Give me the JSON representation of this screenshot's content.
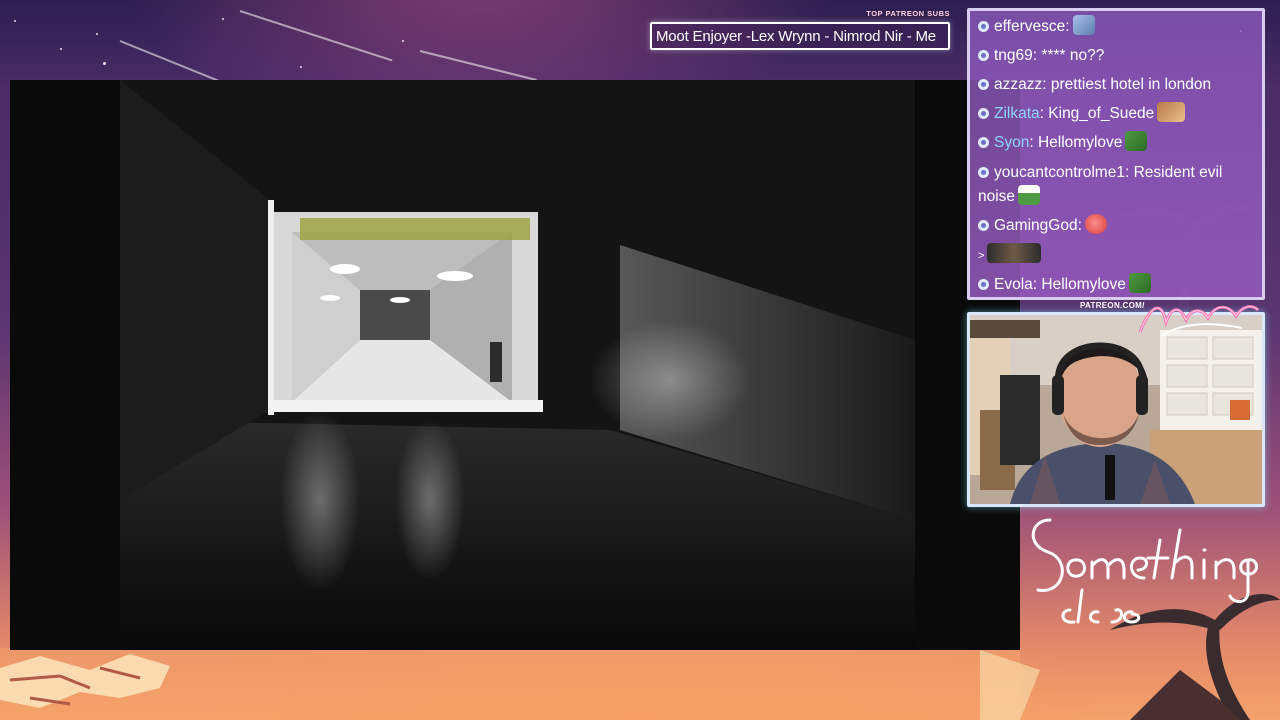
{
  "overlay": {
    "top_subs_label": "TOP PATREON SUBS",
    "top_subs_ticker": "Moot Enjoyer -Lex Wrynn - Nimrod Nir - Me",
    "patreon_url": "PATREON.COM/",
    "cam_logo_text": "Anything else?",
    "brand_logo_text": "Something else"
  },
  "chat": {
    "messages": [
      {
        "user": "effervesce",
        "text": "",
        "emote": "cat-emote",
        "name_color": "white"
      },
      {
        "user": "tng69",
        "text": "**** no??",
        "emote": "",
        "name_color": "white"
      },
      {
        "user": "azzazz",
        "text": "prettiest hotel in london",
        "emote": "",
        "name_color": "white"
      },
      {
        "user": "Zilkata",
        "text": "King_of_Suede",
        "emote": "hand-emote",
        "name_color": "blue"
      },
      {
        "user": "Syon",
        "text": "Hellomylove",
        "emote": "pepe-emote",
        "name_color": "blue"
      },
      {
        "user": "youcantcontrolme1",
        "text": "Resident evil noise",
        "emote": "pepe-emote",
        "name_color": "white"
      },
      {
        "user": "GamingGod",
        "text": "",
        "emote": "blob-emote",
        "name_color": "white"
      },
      {
        "user": "",
        "text": ">",
        "emote": "group-emote",
        "name_color": "white"
      },
      {
        "user": "Evola",
        "text": "Hellomylove",
        "emote": "pepe-emote",
        "name_color": "white"
      }
    ]
  },
  "colors": {
    "chat_bg": "#9a62c2",
    "chat_border": "#d8ccf0",
    "cam_border_glow": "#78f0ff",
    "accent_pink": "#ff5aa0"
  }
}
